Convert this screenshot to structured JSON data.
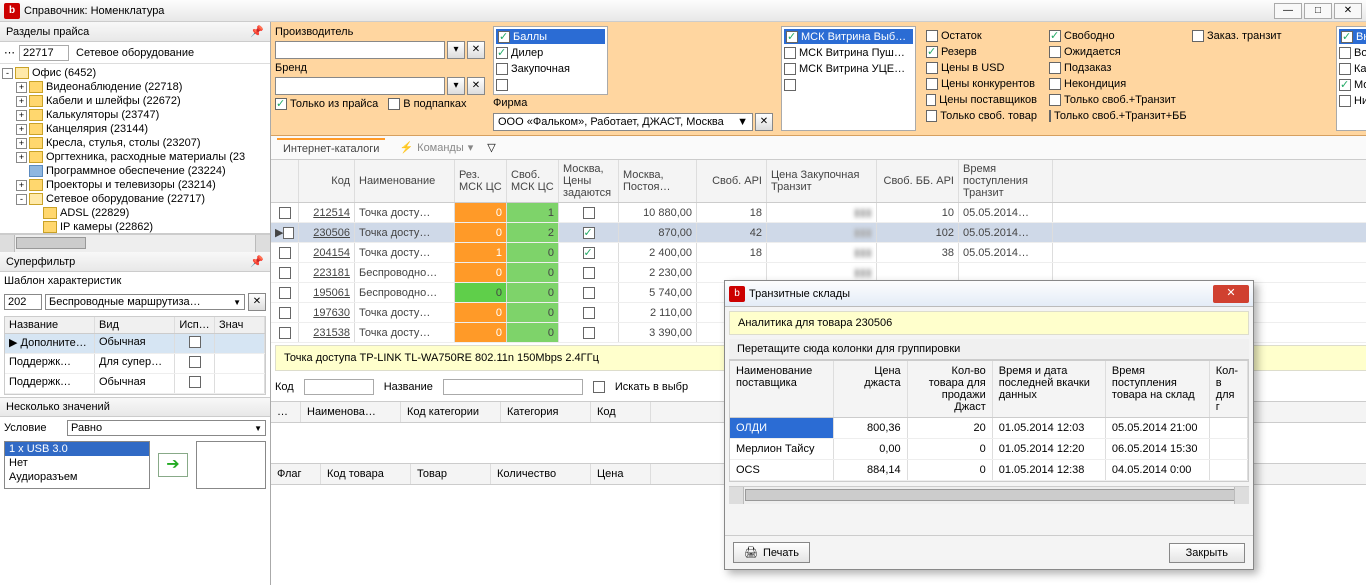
{
  "window": {
    "title": "Справочник: Номенклатура"
  },
  "tree_header": "Разделы прайса",
  "tree_code": "22717",
  "tree_name_sel": "Сетевое оборудование",
  "tree": [
    {
      "ind": 0,
      "exp": "-",
      "open": true,
      "label": "Офис (6452)"
    },
    {
      "ind": 1,
      "exp": "+",
      "label": "Видеонаблюдение (22718)"
    },
    {
      "ind": 1,
      "exp": "+",
      "label": "Кабели и шлейфы (22672)"
    },
    {
      "ind": 1,
      "exp": "+",
      "label": "Калькуляторы (23747)"
    },
    {
      "ind": 1,
      "exp": "+",
      "label": "Канцелярия (23144)"
    },
    {
      "ind": 1,
      "exp": "+",
      "label": "Кресла, стулья, столы (23207)"
    },
    {
      "ind": 1,
      "exp": "+",
      "label": "Оргтехника, расходные материалы (23"
    },
    {
      "ind": 1,
      "exp": "",
      "icon": "sm",
      "label": "Программное обеспечение (23224)"
    },
    {
      "ind": 1,
      "exp": "+",
      "label": "Проекторы и телевизоры (23214)"
    },
    {
      "ind": 1,
      "exp": "-",
      "open": true,
      "label": "Сетевое оборудование (22717)"
    },
    {
      "ind": 2,
      "exp": "",
      "label": "ADSL (22829)"
    },
    {
      "ind": 2,
      "exp": "",
      "label": "IP камеры (22862)"
    }
  ],
  "superfilter": {
    "title": "Суперфильтр",
    "template_label": "Шаблон характеристик",
    "template_code": "202",
    "template_name": "Беспроводные маршрутиза…",
    "cols": [
      "Название",
      "Вид",
      "Исп…",
      "Знач"
    ],
    "rows": [
      {
        "name": "Дополните…",
        "kind": "Обычная",
        "sel": true
      },
      {
        "name": "Поддержк…",
        "kind": "Для супер…"
      },
      {
        "name": "Поддержк…",
        "kind": "Обычная"
      }
    ],
    "values_title": "Несколько значений",
    "cond_label": "Условие",
    "cond_value": "Равно",
    "values": [
      "1 x USB 3.0",
      "Нет",
      "Аудиоразъем"
    ]
  },
  "filters": {
    "manufacturer": "Производитель",
    "brand": "Бренд",
    "only_price": "Только из прайса",
    "in_subfolders": "В подпапках",
    "firma_label": "Фирма",
    "firma_value": "ООО «Фальком», Работает, ДЖАСТ, Москва",
    "col_a": [
      {
        "label": "Баллы",
        "chk": true,
        "hl": true
      },
      {
        "label": "Дилер",
        "chk": true
      },
      {
        "label": "Закупочная"
      },
      {
        "label": ""
      }
    ],
    "col_b": [
      {
        "label": "МСК Витрина Выб…",
        "chk": true,
        "hl": true
      },
      {
        "label": "МСК Витрина Пуш…"
      },
      {
        "label": "МСК Витрина УЦЕ…"
      },
      {
        "label": ""
      }
    ],
    "col_c": [
      {
        "label": "Остаток"
      },
      {
        "label": "Резерв",
        "chk": true
      },
      {
        "label": "Цены в USD"
      },
      {
        "label": "Цены конкурентов"
      },
      {
        "label": "Цены поставщиков"
      },
      {
        "label": "Только своб. товар"
      }
    ],
    "col_d": [
      {
        "label": "Свободно",
        "chk": true
      },
      {
        "label": "Ожидается"
      },
      {
        "label": "Подзаказ"
      },
      {
        "label": "Некондиция"
      },
      {
        "label": "Только своб.+Транзит"
      },
      {
        "label": "Только своб.+Транзит+ББ"
      }
    ],
    "col_e": [
      {
        "label": "Заказ. транзит"
      }
    ],
    "col_f": [
      {
        "label": "Внутренний рибейт",
        "chk": true,
        "hl": true
      },
      {
        "label": "Воронеж"
      },
      {
        "label": "Казань"
      },
      {
        "label": "Москва",
        "chk": true
      },
      {
        "label": "Нижний Новгород"
      }
    ]
  },
  "toolbar2": {
    "tab": "Интернет-каталоги",
    "cmd": "Команды"
  },
  "grid": {
    "cols": [
      "",
      "Код",
      "Наименование",
      "Рез. МСК ЦС",
      "Своб. МСК ЦС",
      "Москва, Цены задаются",
      "Москва, Постоя…",
      "Своб. API",
      "Цена Закупочная Транзит",
      "Своб. ББ. API",
      "Время поступления Транзит"
    ],
    "rows": [
      {
        "code": "212514",
        "name": "Точка досту…",
        "res": "0",
        "free": "1",
        "mc": false,
        "price": "10 880,00",
        "api": "18",
        "zak": "",
        "bb": "10",
        "time": "05.05.2014…"
      },
      {
        "code": "230506",
        "name": "Точка досту…",
        "res": "0",
        "free": "2",
        "mc": true,
        "price": "870,00",
        "api": "42",
        "zak": "",
        "bb": "102",
        "time": "05.05.2014…",
        "sel": true
      },
      {
        "code": "204154",
        "name": "Точка досту…",
        "res": "1",
        "free": "0",
        "mc": true,
        "price": "2 400,00",
        "api": "18",
        "zak": "",
        "bb": "38",
        "time": "05.05.2014…"
      },
      {
        "code": "223181",
        "name": "Беспроводно…",
        "res": "0",
        "free": "0",
        "mc": false,
        "price": "2 230,00",
        "api": "",
        "zak": "",
        "bb": "",
        "time": ""
      },
      {
        "code": "195061",
        "name": "Беспроводно…",
        "res": "0",
        "free": "0",
        "mc": false,
        "price": "5 740,00",
        "api": "",
        "zak": "",
        "bb": "",
        "time": "",
        "green": true
      },
      {
        "code": "197630",
        "name": "Точка досту…",
        "res": "0",
        "free": "0",
        "mc": false,
        "price": "2 110,00",
        "api": "",
        "zak": "",
        "bb": "",
        "time": ""
      },
      {
        "code": "231538",
        "name": "Точка досту…",
        "res": "0",
        "free": "0",
        "mc": false,
        "price": "3 390,00",
        "api": "",
        "zak": "",
        "bb": "",
        "time": ""
      }
    ]
  },
  "detail": "Точка доступа TP-LINK TL-WA750RE 802.11n 150Mbps 2.4ГГц",
  "search": {
    "code_lbl": "Код",
    "name_lbl": "Название",
    "find_in": "Искать в выбр"
  },
  "bottom_cols": [
    "…",
    "Наименова…",
    "Код категории",
    "Категория",
    "Код"
  ],
  "bottom2_cols": [
    "Флаг",
    "Код товара",
    "Товар",
    "Количество",
    "Цена"
  ],
  "modal": {
    "title": "Транзитные склады",
    "info": "Аналитика для товара 230506",
    "group": "Перетащите сюда колонки для группировки",
    "cols": [
      "Наименование поставщика",
      "Цена джаста",
      "Кол-во товара для продажи Джаст",
      "Время и дата последней вкачки данных",
      "Время поступления товара на склад",
      "Кол-в для г"
    ],
    "rows": [
      {
        "sup": "ОЛДИ",
        "price": "800,36",
        "qty": "20",
        "t1": "01.05.2014 12:03",
        "t2": "05.05.2014 21:00",
        "sel": true
      },
      {
        "sup": "Мерлион Тайсу",
        "price": "0,00",
        "qty": "0",
        "t1": "01.05.2014 12:20",
        "t2": "06.05.2014 15:30"
      },
      {
        "sup": "OCS",
        "price": "884,14",
        "qty": "0",
        "t1": "01.05.2014 12:38",
        "t2": "04.05.2014 0:00"
      }
    ],
    "print": "Печать",
    "close": "Закрыть"
  }
}
